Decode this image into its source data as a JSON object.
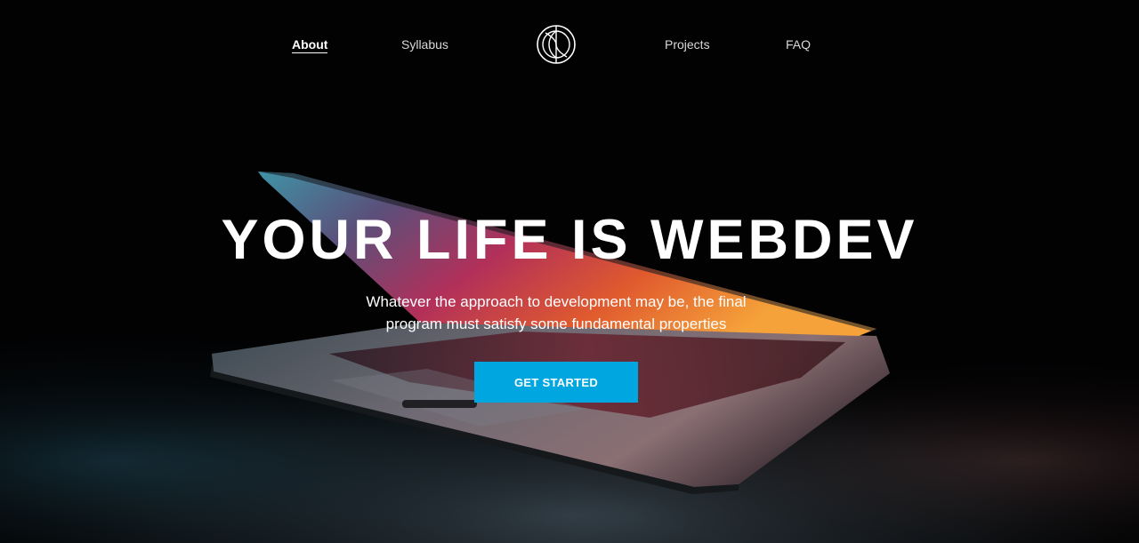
{
  "nav": {
    "items": [
      {
        "label": "About",
        "active": true
      },
      {
        "label": "Syllabus",
        "active": false
      },
      {
        "label": "Projects",
        "active": false
      },
      {
        "label": "FAQ",
        "active": false
      }
    ],
    "logo_icon": "globe-icon"
  },
  "hero": {
    "headline": "YOUR LIFE IS WEBDEV",
    "subtitle": "Whatever the approach to development may be, the final program must satisfy some fundamental properties",
    "cta_label": "GET STARTED"
  },
  "colors": {
    "accent": "#00a6e0",
    "background": "#000000",
    "text": "#ffffff"
  }
}
